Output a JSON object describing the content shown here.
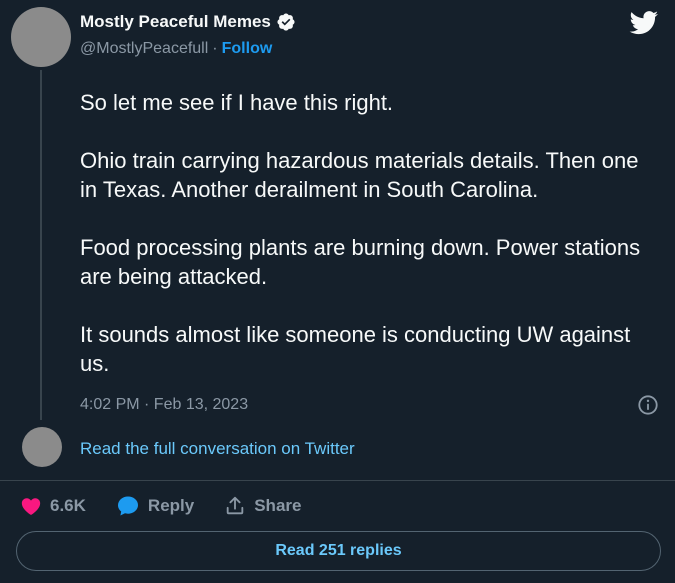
{
  "author": {
    "name": "Mostly Peaceful Memes",
    "handle": "@MostlyPeacefull",
    "separator": "·",
    "follow_label": "Follow"
  },
  "tweet": {
    "paragraphs": [
      "So let me see if I have this right.",
      "Ohio train carrying hazardous materials details. Then one in Texas. Another derailment in South Carolina.",
      "Food processing plants are burning down. Power stations are being attacked.",
      "It sounds almost like someone is conducting UW against us."
    ],
    "timestamp": "4:02 PM · Feb 13, 2023"
  },
  "thread": {
    "read_full_label": "Read the full conversation on Twitter"
  },
  "actions": {
    "likes": "6.6K",
    "reply_label": "Reply",
    "share_label": "Share"
  },
  "footer": {
    "read_replies_label": "Read 251 replies"
  },
  "colors": {
    "background": "#15202b",
    "accent": "#1d9bf0",
    "link": "#6bc9fb",
    "like": "#f91880",
    "muted": "#8b98a5"
  },
  "icons": {
    "verified": "verified-badge-icon",
    "twitter": "twitter-bird-icon",
    "info": "info-icon",
    "like": "heart-icon",
    "reply": "speech-bubble-icon",
    "share": "share-upload-icon"
  }
}
